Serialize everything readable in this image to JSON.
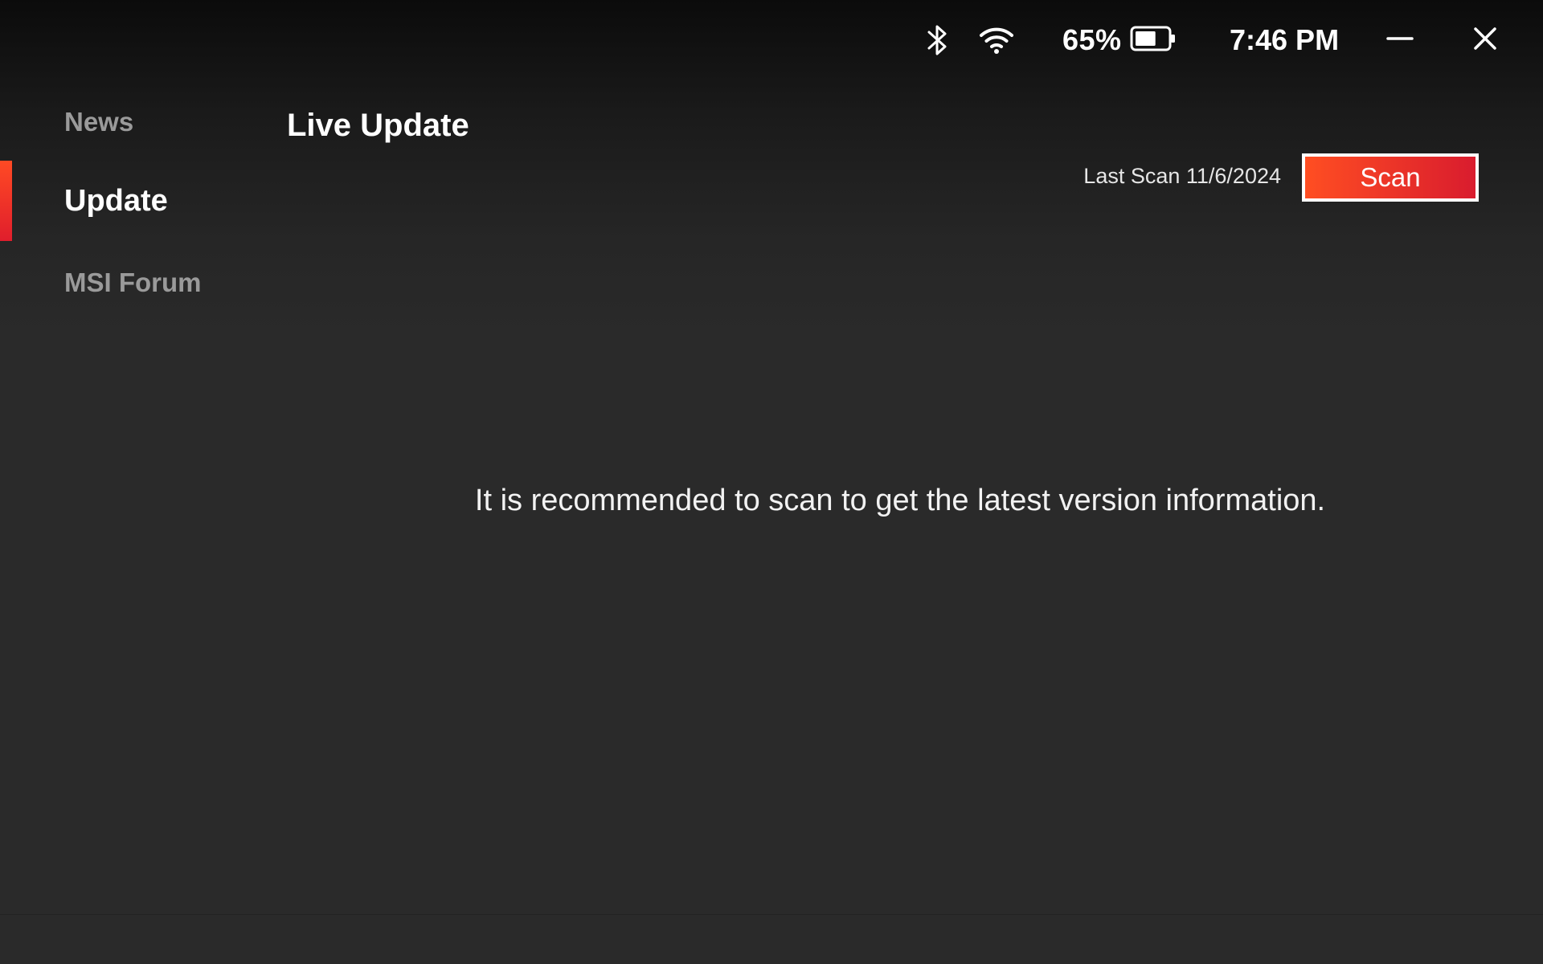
{
  "status_bar": {
    "bluetooth_icon": "bluetooth-icon",
    "wifi_icon": "wifi-icon",
    "battery_percent": "65%",
    "battery_level": 0.65,
    "battery_icon": "battery-icon",
    "time": "7:46 PM"
  },
  "window_controls": {
    "minimize_icon": "minimize-icon",
    "close_icon": "close-icon"
  },
  "sidebar": {
    "items": [
      {
        "label": "News",
        "active": false
      },
      {
        "label": "Update",
        "active": true
      },
      {
        "label": "MSI Forum",
        "active": false
      }
    ]
  },
  "main": {
    "title": "Live Update",
    "last_scan": "Last Scan 11/6/2024",
    "scan_button_label": "Scan",
    "message": "It is recommended to scan to get the latest version information."
  },
  "colors": {
    "accent_start": "#ff4e22",
    "accent_end": "#d91c2e",
    "background": "#2a2a2a",
    "inactive_text": "#9a9a9a"
  }
}
